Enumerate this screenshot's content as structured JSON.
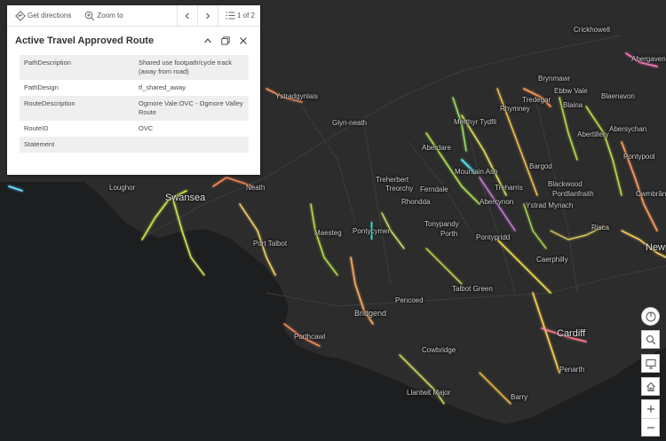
{
  "popup": {
    "get_directions": "Get directions",
    "zoom_to": "Zoom to",
    "pager": "1 of 2",
    "title": "Active Travel Approved Route",
    "attributes": [
      {
        "key": "PathDescription",
        "value": "Shared use footpath/cycle track (away from road)"
      },
      {
        "key": "PathDesign",
        "value": "tf_shared_away"
      },
      {
        "key": "RouteDescription",
        "value": "Ogmore Vale:OVC - Ogmore Valley Route"
      },
      {
        "key": "RouteID",
        "value": "OVC"
      },
      {
        "key": "Statement",
        "value": ""
      }
    ]
  },
  "places": {
    "crickhowell": "Crickhowell",
    "abergavenny": "Abergavenn",
    "ystradgynlais": "Ystradgynlais",
    "brynmawr": "Brynmawr",
    "ebbw_vale": "Ebbw Vale",
    "blaenavon": "Blaenavon",
    "tredegar": "Tredegar",
    "rhymney": "Rhymney",
    "blaina": "Blaina",
    "glyn_neath": "Glyn-neath",
    "merthyr": "Merthyr Tydfil",
    "abertillery": "Abertillery",
    "abersychan": "Abersychan",
    "aberdare": "Aberdare",
    "pontypool": "Pontypool",
    "bargod": "Bargod",
    "mountain_ash": "Mountain Ash",
    "loughor": "Loughor",
    "neath": "Neath",
    "treherbert": "Treherbert",
    "treorchy": "Treorchy",
    "ferndale": "Ferndale",
    "treharris": "Treharris",
    "blackwood": "Blackwood",
    "pontllanfraith": "Pontllanfraith",
    "cwmbran": "Cwmbrân",
    "swansea": "Swansea",
    "rhondda": "Rhondda",
    "abercynon": "Abercynon",
    "ystrad_mynach": "Ystrad Mynach",
    "maesteg": "Maesteg",
    "pontycymer": "Pontycymer",
    "tonypandy": "Tonypandy",
    "porth": "Porth",
    "risca": "Risca",
    "port_talbot": "Port Talbot",
    "pontypridd": "Pontypridd",
    "caerphilly": "Caerphilly",
    "newport": "Newp",
    "talbot_green": "Talbot Green",
    "pencoed": "Pencoed",
    "bridgend": "Bridgend",
    "cardiff": "Cardiff",
    "porthcawl": "Porthcawl",
    "cowbridge": "Cowbridge",
    "penarth": "Penarth",
    "llantwit_major": "Llantwit Major",
    "barry": "Barry"
  },
  "colors": {
    "map_land": "#2c2c2c",
    "map_sea": "#1c1d1f",
    "route_highlight": "#2fe0c8"
  },
  "icons": {
    "directions": "diamond-arrow-icon",
    "zoom": "magnifier-plus-icon",
    "prev": "chevron-left-icon",
    "next": "chevron-right-icon",
    "list": "list-icon",
    "collapse": "chevron-up-icon",
    "dock": "dock-icon",
    "close": "close-icon",
    "locate": "locate-icon",
    "search": "search-icon",
    "basemap": "monitor-icon",
    "home": "home-icon"
  }
}
